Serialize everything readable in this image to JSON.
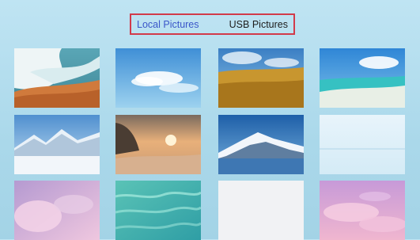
{
  "tabs": {
    "local_label": "Local Pictures",
    "usb_label": "USB Pictures",
    "active": "local"
  },
  "colors": {
    "background": "#aad8ea",
    "tab_border": "#d23a4a",
    "active_tab": "#3b57c9"
  },
  "gallery": {
    "rows": 3,
    "columns": 4,
    "items": [
      {
        "subject": "ocean wave on sand"
      },
      {
        "subject": "blue sky with clouds"
      },
      {
        "subject": "wheat field under blue sky"
      },
      {
        "subject": "tropical turquoise beach"
      },
      {
        "subject": "snowy mountains"
      },
      {
        "subject": "rocky coast at sunset"
      },
      {
        "subject": "snow-capped mountain over sea"
      },
      {
        "subject": "pale misty sea"
      },
      {
        "subject": "pink clouds"
      },
      {
        "subject": "turquoise water surface"
      },
      {
        "subject": "plain white"
      },
      {
        "subject": "pink cloudy sky"
      }
    ]
  }
}
